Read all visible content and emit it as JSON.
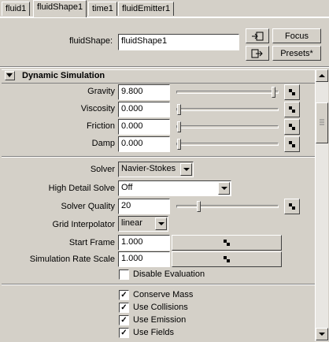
{
  "tabs": [
    "fluid1",
    "fluidShape1",
    "time1",
    "fluidEmitter1"
  ],
  "active_tab": "fluidShape1",
  "header": {
    "shape_label": "fluidShape:",
    "shape_value": "fluidShape1",
    "focus_label": "Focus",
    "presets_label": "Presets*"
  },
  "section": {
    "title": "Dynamic Simulation"
  },
  "sliders": [
    {
      "label": "Gravity",
      "value": "9.800"
    },
    {
      "label": "Viscosity",
      "value": "0.000"
    },
    {
      "label": "Friction",
      "value": "0.000"
    },
    {
      "label": "Damp",
      "value": "0.000"
    }
  ],
  "solver": {
    "label": "Solver",
    "value": "Navier-Stokes"
  },
  "high_detail": {
    "label": "High Detail Solve",
    "value": "Off"
  },
  "solver_quality": {
    "label": "Solver Quality",
    "value": "20"
  },
  "grid_interp": {
    "label": "Grid Interpolator",
    "value": "linear"
  },
  "start_frame": {
    "label": "Start Frame",
    "value": "1.000"
  },
  "sim_rate": {
    "label": "Simulation Rate Scale",
    "value": "1.000"
  },
  "disable_eval": {
    "label": "Disable Evaluation",
    "checked": false
  },
  "checkboxes": [
    {
      "label": "Conserve Mass",
      "checked": true
    },
    {
      "label": "Use Collisions",
      "checked": true
    },
    {
      "label": "Use Emission",
      "checked": true
    },
    {
      "label": "Use Fields",
      "checked": true
    }
  ]
}
